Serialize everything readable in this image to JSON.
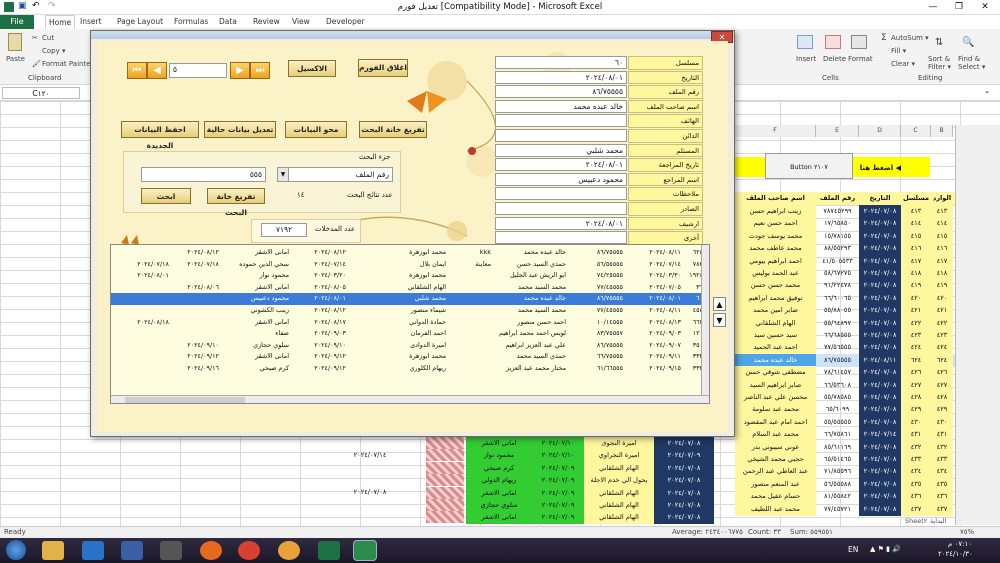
{
  "window": {
    "title": "تعديل فورم  [Compatibility Mode]  -  Microsoft Excel",
    "min": "—",
    "max": "❐",
    "close": "✕"
  },
  "quick_access": {
    "save": "save-icon",
    "undo": "↶",
    "redo": "↷"
  },
  "tabs": [
    "File",
    "Home",
    "Insert",
    "Page Layout",
    "Formulas",
    "Data",
    "Review",
    "View",
    "Developer"
  ],
  "ribbon": {
    "clipboard": {
      "paste": "Paste",
      "cut": "Cut",
      "copy": "Copy ▾",
      "format_painter": "Format Painter",
      "group": "Clipboard"
    },
    "insert": "Insert",
    "delete": "Delete",
    "format": "Format",
    "cells_group": "Cells",
    "autosum": "AutoSum ▾",
    "fill": "Fill ▾",
    "clear": "Clear ▾",
    "sort_filter": "Sort & Filter ▾",
    "find_select": "Find & Select ▾",
    "editing_group": "Editing"
  },
  "formula_bar": {
    "cell_ref": "C١٢٠"
  },
  "dialog": {
    "nav": {
      "first": "⏮",
      "prev": "◀",
      "next": "▶",
      "last": "⏭",
      "record": "٥"
    },
    "buttons": {
      "close_form": "اغلاق الفورم",
      "excel": "الاكسيل",
      "empty_fields": "تفريغ خانة البحث",
      "delete_data": "محو البيانات",
      "edit_data": "تعديل بيانات حالية",
      "save_new": "احفظ البيانات الجديدة",
      "search": "ابحث",
      "empty_search": "تفريغ خانة البحث"
    },
    "search": {
      "group_label": "جزء البحث",
      "field": "رقم الملف",
      "value": "٥٥٥",
      "results_label": "عدد نتائج البحث",
      "results_count": "١٤"
    },
    "records": {
      "label": "عدد المدخلات",
      "value": "٧١٩٢"
    },
    "fields": [
      {
        "label": "مسلسل",
        "value": "٦٠"
      },
      {
        "label": "التاريخ",
        "value": "٢٠٢٤/٠٨/٠١"
      },
      {
        "label": "رقم الملف",
        "value": "٨٦/٧٥٥٥٥"
      },
      {
        "label": "اسم صاحب الملف",
        "value": "خالد عبده محمد"
      },
      {
        "label": "الهاتف",
        "value": ""
      },
      {
        "label": "الدائن",
        "value": ""
      },
      {
        "label": "المستلم",
        "value": "محمد شلبي"
      },
      {
        "label": "تاريخ المراجعة",
        "value": "٢٠٢٤/٠٨/٠١"
      },
      {
        "label": "اسم المراجع",
        "value": "محمود دعبيس"
      },
      {
        "label": "ملاحظات",
        "value": ""
      },
      {
        "label": "الصادر",
        "value": ""
      },
      {
        "label": "ارشيف",
        "value": "٢٠٢٤/٠٨/٠١"
      },
      {
        "label": "أخرى",
        "value": ""
      }
    ],
    "rows": [
      [
        "٦٢٤",
        "٢٠٢٤/٠٨/١١",
        "٨٦/٧٥٥٥٥",
        "خالد عبده محمد",
        "kkk",
        "محمد ابوزهرة",
        "٢٠٢٤/٠٨/١٢",
        "امانى الاشقر",
        "٢٠٢٤/٠٨/١٢",
        ""
      ],
      [
        "٧٨٣",
        "٢٠٢٤/٠٧/١٤",
        "٥٦/٥٥٥٥٥",
        "حمدي السيد حسن",
        "معاينة",
        "ايمان بلال",
        "٢٠٢٤/٠٧/١٤",
        "سحي الدين حموده",
        "٢٠٢٤/٠٧/١٨",
        "٢٠٢٤/٠٧/١٨"
      ],
      [
        "١٩٢٤",
        "٢٠٢٤/٠٣/٣٠",
        "٧٤/٢٥٥٥٥",
        "ابو الريش عبد الجليل",
        "",
        "محمد ابوزهرة",
        "٢٠٢٤/٠٣/٢٠",
        "محمود نوار",
        "",
        "٢٠٢٤/٠٨/٠١"
      ],
      [
        "٣٦",
        "٢٠٢٤/٠٧/٠٥",
        "٧٧/٤٥٥٥٥",
        "محمد السيد محمد",
        "",
        "الهام الشلقاني",
        "٢٠٢٤/٠٨/٠٥",
        "امانى الاشقر",
        "٢٠٢٤/٠٨/٠٦",
        ""
      ],
      [
        "٦٠",
        "٢٠٢٤/٠٨/٠١",
        "٨٦/٧٥٥٥٥",
        "خالد عبده محمد",
        "",
        "محمد شلبي",
        "٢٠٢٤/٠٨/٠١",
        "محمود دعبيس",
        "",
        ""
      ],
      [
        "٤٥٤",
        "٢٠٢٤/٠٨/١١",
        "٧٧/٤٥٥٥٥",
        "محمد السيد محمد",
        "",
        "شيماء منصور",
        "٢٠٢٤/٠٨/١٢",
        "زينب الكشوني",
        "",
        ""
      ],
      [
        "٦٦٢",
        "٢٠٢٤/٠٨/١٣",
        "١٠/١٤٥٥٥",
        "احمد حسن منصور",
        "",
        "حمادة الدواني",
        "٢٠٢٤/٠٨/١٧",
        "امانى الاشقر",
        "",
        "٢٠٢٤/٠٨/١٨"
      ],
      [
        "١٢٠",
        "٢٠٢٤/٠٩/٠٣",
        "٨٣/٧٥٥٥٧",
        "لويس احمد محمد ابراهيم",
        "",
        "احمد الفرمان",
        "٢٠٢٤/٠٩/٠٣",
        "صفاء",
        "",
        ""
      ],
      [
        "٣٥٠",
        "٢٠٢٤/٠٩/٠٧",
        "٨٦/٧٥٥٥٥",
        "علي عبد العزيز ابراهيم",
        "",
        "اميرة الدوادى",
        "٢٠٢٤/٠٩/١٠",
        "سلوي حجازي",
        "٢٠٢٤/٠٩/١٠",
        ""
      ],
      [
        "٣٣٣",
        "٢٠٢٤/٠٩/١١",
        "٦٦/٧٥٥٥٥",
        "حمدي السيد محمد",
        "",
        "محمد ابوزهرة",
        "٢٠٢٤/٠٩/١٢",
        "امانى الاشقر",
        "٢٠٢٤/٠٩/١٢",
        ""
      ],
      [
        "٣٣٣",
        "٢٠٢٤/٠٩/١٥",
        "٦١/٦٦٥٥٥",
        "مختار محمد عبد العزيز",
        "",
        "ريهام الكلوري",
        "٢٠٢٤/٠٩/١٢",
        "كرم صبحي",
        "٢٠٢٤/٠٩/١٦",
        ""
      ]
    ],
    "up_arrow": "▲",
    "down_arrow": "▼"
  },
  "sheet": {
    "button_tag": "Button ٢١٠٧",
    "hint": "اضغط هنا",
    "col_letters": [
      "B",
      "C",
      "D",
      "E",
      "F"
    ],
    "headers": [
      "الوارد",
      "مسلسل",
      "التاريخ",
      "رقم الملف",
      "اسم صاحب الملف"
    ],
    "right_rows": [
      [
        "٤١٣",
        "٤١٣",
        "٢٠٢٤/٠٧/٠٨",
        "٧٨٧٤٥٢٩٩",
        "زينب ابراهيم حسن"
      ],
      [
        "٤١٤",
        "٤١٤",
        "٢٠٢٤/٠٧/٠٨",
        "١٧/٦٥٨٥٠",
        "احمد حسن نعيم"
      ],
      [
        "٤١٥",
        "٤١٥",
        "٢٠٢٤/٠٧/٠٨",
        "١٥/٧٨١٥٥",
        "محمد يوسف جودت"
      ],
      [
        "٤١٦",
        "٤١٦",
        "٢٠٢٤/٠٧/٠٨",
        "٨٨/٥٥٢٩٣",
        "محمد عاطف محمد"
      ],
      [
        "٤١٧",
        "٤١٧",
        "٢٠٢٤/٠٧/٠٨",
        "٤١/٥٠٥٥٣٣",
        "احمد ابراهيم بيومي"
      ],
      [
        "٤١٨",
        "٤١٨",
        "٢٠٢٤/٠٧/٠٨",
        "٥٨/٦٧٢٧٥",
        "عبد الحمد بوليس"
      ],
      [
        "٤١٩",
        "٤١٩",
        "٢٠٢٤/٠٧/٠٨",
        "٩١/٢٢٤٧٨",
        "محمد حسن حسن"
      ],
      [
        "٤٢٠",
        "٤٢٠",
        "٢٠٢٤/٠٧/٠٨",
        "٦٦/٦٠٠٦٥",
        "توفيق محمد ابراهيم"
      ],
      [
        "٤٢١",
        "٤٢١",
        "٢٠٢٤/٠٧/٠٨",
        "٥٥/٨٨٠٥٥",
        "صابر امين محمد"
      ],
      [
        "٤٢٢",
        "٤٢٢",
        "٢٠٢٤/٠٧/٠٨",
        "٥٥/٦٤٨٩٧",
        "الهام الشلقاني"
      ],
      [
        "٤٢٣",
        "٤٢٣",
        "٢٠٢٤/٠٧/٠٨",
        "٦٦/٦٨٥٥٥",
        "سيد حسين سيد"
      ],
      [
        "٤٢٤",
        "٤٢٤",
        "٢٠٢٤/٠٧/٠٨",
        "٧٧/٥٦٥٥٥",
        "احمد عبد الحميد"
      ],
      [
        "٦٢٤",
        "٦٢٤",
        "٢٠٢٤/٠٨/١١",
        "٨٦/٧٥٥٥٥",
        "خالد عبده محمد"
      ],
      [
        "٤٢٦",
        "٤٢٦",
        "٢٠٢٤/٠٧/٠٨",
        "٧٨/٦١٤٥٧",
        "مصطفى شوقي حسن"
      ],
      [
        "٤٢٧",
        "٤٢٧",
        "٢٠٢٤/٠٧/٠٨",
        "٦٦/٥٣٦٠٨",
        "صابر ابراهيم السيد"
      ],
      [
        "٤٢٨",
        "٤٢٨",
        "٢٠٢٤/٠٧/٠٨",
        "٥٥/٧٨٥٨٥",
        "محسن علي عبد الناصر"
      ],
      [
        "٤٢٩",
        "٤٢٩",
        "٢٠٢٤/٠٧/٠٨",
        "٦٥/٦٠٩٩",
        "محمد عبد سلومة"
      ],
      [
        "٤٣٠",
        "٤٣٠",
        "٢٠٢٤/٠٧/٠٨",
        "٥٥/٥٥٥٥٥",
        "احمد امام عبد المقصود"
      ],
      [
        "٤٣١",
        "٤٣١",
        "٢٠٢٤/٠٧/١٤",
        "٦٦/٧٥٨٦١",
        "محمد عبد السلام"
      ],
      [
        "٤٣٢",
        "٤٣٢",
        "٢٠٢٤/٠٧/٠٨",
        "٨٥/٦١١٦٩",
        "عوني سيبوني بدر"
      ],
      [
        "٤٣٣",
        "٤٣٣",
        "٢٠٢٤/٠٧/٠٨",
        "٦٥/٥١٤٦٥",
        "حجبي محمد الشيخي"
      ],
      [
        "٤٣٤",
        "٤٣٤",
        "٢٠٢٤/٠٧/٠٨",
        "٧١/٨٥٥٩٦",
        "عبد العاطي عبد الرحمن"
      ],
      [
        "٤٣٥",
        "٤٣٥",
        "٢٠٢٤/٠٧/٠٨",
        "٥٦/٥٥٥٨٨",
        "عبد المنعم منصور"
      ],
      [
        "٤٣٦",
        "٤٣٦",
        "٢٠٢٤/٠٧/٠٨",
        "٨١/٥٥٨٤٢",
        "حسام عقيل محمد"
      ],
      [
        "٤٣٧",
        "٤٣٧",
        "٢٠٢٤/٠٧/٠٨",
        "٧٧/٤٥٧٢١",
        "محمد عبد اللطيف"
      ]
    ],
    "lower_rows": [
      [
        "امانى الاشقر",
        "٢٠٢٤/٠٧/١٠",
        "اميرة النجوى",
        "٢٠٢٤/٠٧/٠٨"
      ],
      [
        "محمود نوار",
        "٢٠٢٤/٠٧/١٠",
        "اميرة النجراوي",
        "٢٠٢٤/٠٧/٠٩"
      ],
      [
        "كرم صبحي",
        "٢٠٢٤/٠٧/٠٩",
        "الهام الشلقاني",
        "٢٠٢٤/٠٧/٠٨"
      ],
      [
        "ريهام الدولي",
        "٢٠٢٤/٠٧/٠٩",
        "يحول الي خدم الاجلة",
        "٢٠٢٤/٠٧/٠٨"
      ],
      [
        "امانى الاشقر",
        "٢٠٢٤/٠٧/٠٩",
        "الهام الشلقاني",
        "٢٠٢٤/٠٧/٠٨"
      ],
      [
        "سلوي حجازي",
        "٢٠٢٤/٠٧/٠٩",
        "الهام الشلقاني",
        "٢٠٢٤/٠٧/٠٨"
      ],
      [
        "امانى الاشقر",
        "٢٠٢٤/٠٧/٠٩",
        "الهام الشلقاني",
        "٢٠٢٤/٠٧/٠٨"
      ]
    ],
    "far_dates": [
      "٢٠٢٤/٠٧/١٤",
      "٢٠٢٤/٠٧/٠٨"
    ]
  },
  "status": {
    "ready": "Ready",
    "average": "Average: ٢٤٣٤٠٠٦٧٧٥",
    "count": "Count: ٣٣",
    "sum": "Sum: ٥٥٩٥٥١",
    "zoom": "٧٥%",
    "sheets": [
      "Sheet٢",
      "Sheet٣",
      "Sheet١",
      "البداية"
    ]
  },
  "taskbar": {
    "lang": "EN",
    "time": "٠٧:١٠ م",
    "date": "٢٠٢٤/١٠/٣٠"
  },
  "colors": {
    "excel_green": "#1e7145",
    "yellow": "#fff79e",
    "selection": "#3d7bd8",
    "green_cell": "#33cc33",
    "red_cell": "#d98c8c"
  }
}
